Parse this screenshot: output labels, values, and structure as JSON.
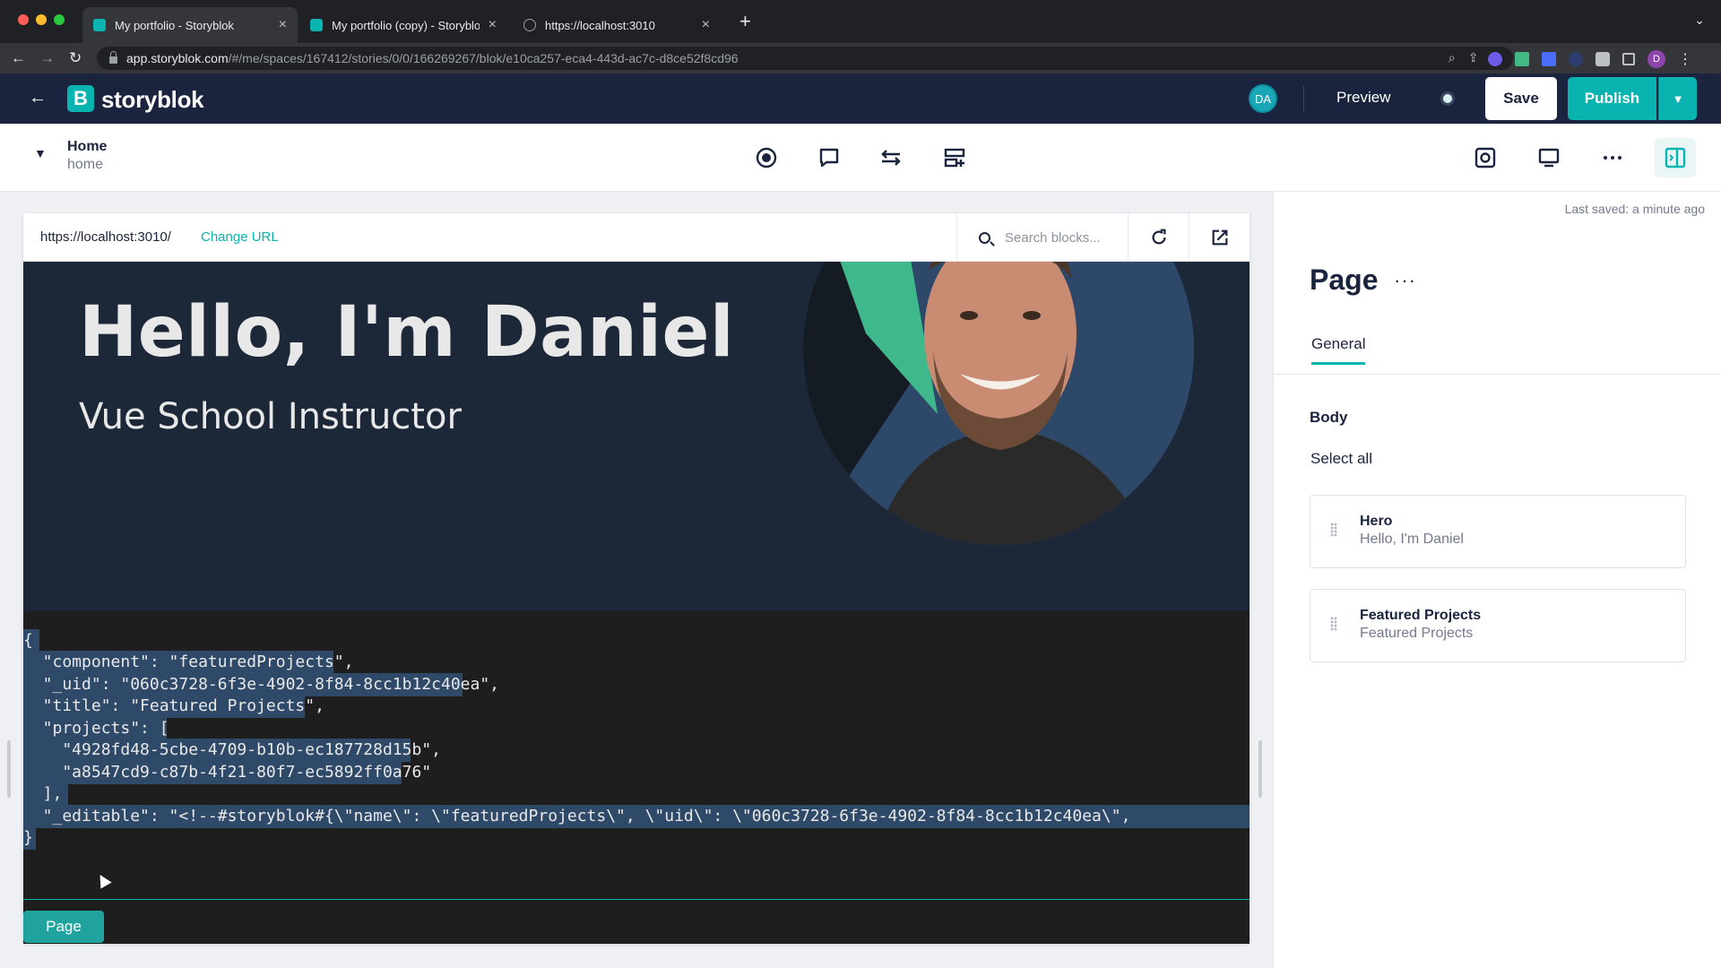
{
  "browser": {
    "tabs": [
      {
        "title": "My portfolio - Storyblok",
        "active": true
      },
      {
        "title": "My portfolio (copy) - Storyblok",
        "active": false
      },
      {
        "title": "https://localhost:3010",
        "active": false
      }
    ],
    "url_host": "app.storyblok.com",
    "url_path": "/#/me/spaces/167412/stories/0/0/166269267/blok/e10ca257-eca4-443d-ac7c-d8ce52f8cd96",
    "profile_initial": "D"
  },
  "header": {
    "brand": "storyblok",
    "brand_mark": "B",
    "avatar_initials": "DA",
    "preview_label": "Preview",
    "save_label": "Save",
    "publish_label": "Publish",
    "accent_color": "#09b3af",
    "header_color": "#1b243f"
  },
  "toolbar": {
    "story_name": "Home",
    "story_slug": "home",
    "icons": [
      "record-icon",
      "comment-icon",
      "settings-sliders-icon",
      "add-block-icon",
      "screenshot-icon",
      "desktop-view-icon",
      "more-icon",
      "layout-panel-icon"
    ]
  },
  "preview": {
    "url": "https://localhost:3010/",
    "change_url_label": "Change URL",
    "search_placeholder": "Search blocks...",
    "hero_title": "Hello, I'm Daniel",
    "hero_subtitle": "Vue School Instructor",
    "code_lines": [
      "{",
      "  \"component\": \"featuredProjects\",",
      "  \"_uid\": \"060c3728-6f3e-4902-8f84-8cc1b12c40ea\",",
      "  \"title\": \"Featured Projects\",",
      "  \"projects\": [",
      "    \"4928fd48-5cbe-4709-b10b-ec187728d15b\",",
      "    \"a8547cd9-c87b-4f21-80f7-ec5892ff0a76\"",
      "  ],",
      "  \"_editable\": \"<!--#storyblok#{\\\"name\\\": \\\"featuredProjects\\\", \\\"uid\\\": \\\"060c3728-6f3e-4902-8f84-8cc1b12c40ea\\\",",
      "}"
    ],
    "page_pill": "Page"
  },
  "panel": {
    "last_saved": "Last saved: a minute ago",
    "title": "Page",
    "more": "···",
    "tab_general": "General",
    "body_label": "Body",
    "select_all": "Select all",
    "blocks": [
      {
        "name": "Hero",
        "desc": "Hello, I'm Daniel"
      },
      {
        "name": "Featured Projects",
        "desc": "Featured Projects"
      }
    ]
  }
}
